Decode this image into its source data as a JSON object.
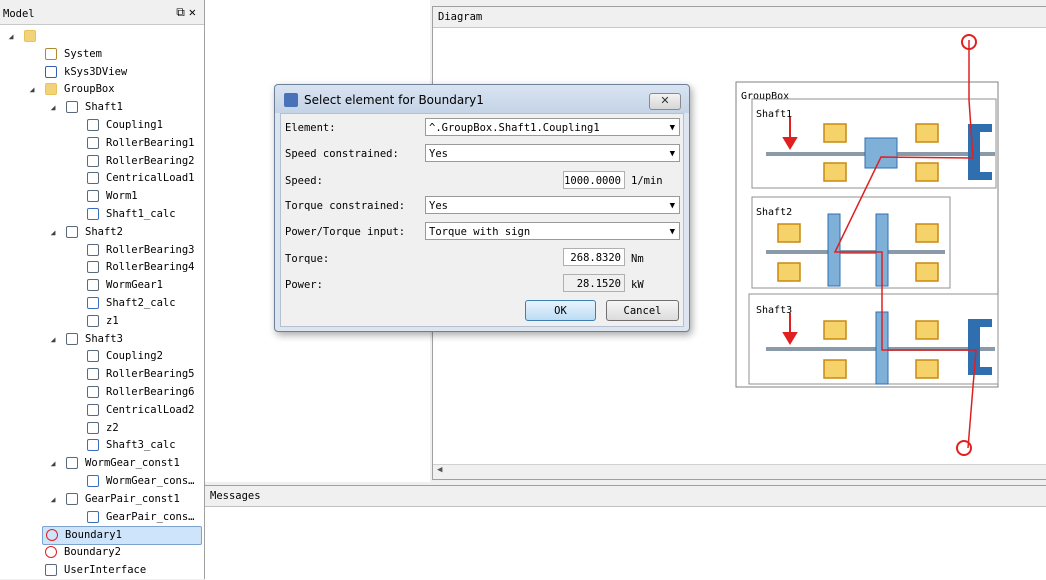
{
  "model_panel": {
    "title": "Model",
    "controls": "⧉✕",
    "tree": [
      {
        "label": "",
        "level": 0,
        "icon": "folder-open-icon",
        "expander": "◢"
      },
      {
        "label": "System",
        "level": 1,
        "icon": "system-gears-icon"
      },
      {
        "label": "kSys3DView",
        "level": 1,
        "icon": "3d-view-icon"
      },
      {
        "label": "GroupBox",
        "level": 1,
        "icon": "folder-icon",
        "expander": "◢"
      },
      {
        "label": "Shaft1",
        "level": 2,
        "icon": "shaft-icon",
        "expander": "◢"
      },
      {
        "label": "Coupling1",
        "level": 3,
        "icon": "coupling-icon"
      },
      {
        "label": "RollerBearing1",
        "level": 3,
        "icon": "bearing-icon"
      },
      {
        "label": "RollerBearing2",
        "level": 3,
        "icon": "bearing-icon"
      },
      {
        "label": "CentricalLoad1",
        "level": 3,
        "icon": "load-icon"
      },
      {
        "label": "Worm1",
        "level": 3,
        "icon": "worm-icon"
      },
      {
        "label": "Shaft1_calc",
        "level": 3,
        "icon": "calc-icon"
      },
      {
        "label": "Shaft2",
        "level": 2,
        "icon": "shaft-icon",
        "expander": "◢"
      },
      {
        "label": "RollerBearing3",
        "level": 3,
        "icon": "bearing-icon"
      },
      {
        "label": "RollerBearing4",
        "level": 3,
        "icon": "bearing-icon"
      },
      {
        "label": "WormGear1",
        "level": 3,
        "icon": "worm-gear-icon"
      },
      {
        "label": "Shaft2_calc",
        "level": 3,
        "icon": "calc-icon"
      },
      {
        "label": "z1",
        "level": 3,
        "icon": "gear-icon"
      },
      {
        "label": "Shaft3",
        "level": 2,
        "icon": "shaft-icon",
        "expander": "◢"
      },
      {
        "label": "Coupling2",
        "level": 3,
        "icon": "coupling-icon"
      },
      {
        "label": "RollerBearing5",
        "level": 3,
        "icon": "bearing-icon"
      },
      {
        "label": "RollerBearing6",
        "level": 3,
        "icon": "bearing-icon"
      },
      {
        "label": "CentricalLoad2",
        "level": 3,
        "icon": "load-icon"
      },
      {
        "label": "z2",
        "level": 3,
        "icon": "gear-icon"
      },
      {
        "label": "Shaft3_calc",
        "level": 3,
        "icon": "calc-icon"
      },
      {
        "label": "WormGear_const1",
        "level": 2,
        "icon": "constraint-icon",
        "expander": "◢"
      },
      {
        "label": "WormGear_cons…",
        "level": 3,
        "icon": "worm-calc-icon"
      },
      {
        "label": "GearPair_const1",
        "level": 2,
        "icon": "constraint-icon",
        "expander": "◢"
      },
      {
        "label": "GearPair_cons…",
        "level": 3,
        "icon": "gearpair-calc-icon"
      },
      {
        "label": "Boundary1",
        "level": 1,
        "icon": "boundary-icon",
        "selected": true
      },
      {
        "label": "Boundary2",
        "level": 1,
        "icon": "boundary-icon"
      },
      {
        "label": "UserInterface",
        "level": 1,
        "icon": "ui-icon"
      }
    ]
  },
  "diagram": {
    "title": "Diagram",
    "groupbox_label": "GroupBox",
    "shafts": [
      "Shaft1",
      "Shaft2",
      "Shaft3"
    ],
    "scroll_left": "◀"
  },
  "messages": {
    "title": "Messages"
  },
  "dialog": {
    "title": "Select element for Boundary1",
    "close": "✕",
    "element_label": "Element:",
    "element_value": "^.GroupBox.Shaft1.Coupling1",
    "speed_constrained_label": "Speed constrained:",
    "speed_constrained_value": "Yes",
    "speed_label": "Speed:",
    "speed_value": "1000.0000",
    "speed_unit": "1/min",
    "torque_constrained_label": "Torque constrained:",
    "torque_constrained_value": "Yes",
    "power_torque_label": "Power/Torque input:",
    "power_torque_value": "Torque with sign",
    "torque_label": "Torque:",
    "torque_value": "268.8320",
    "torque_unit": "Nm",
    "power_label": "Power:",
    "power_value": "28.1520",
    "power_unit": "kW",
    "ok": "OK",
    "cancel": "Cancel",
    "dropdown_arrow": "▼"
  },
  "colors": {
    "accent_red": "#e02020",
    "bearing_yellow": "#f0c030",
    "shaft_blue": "#2f6fb0"
  }
}
